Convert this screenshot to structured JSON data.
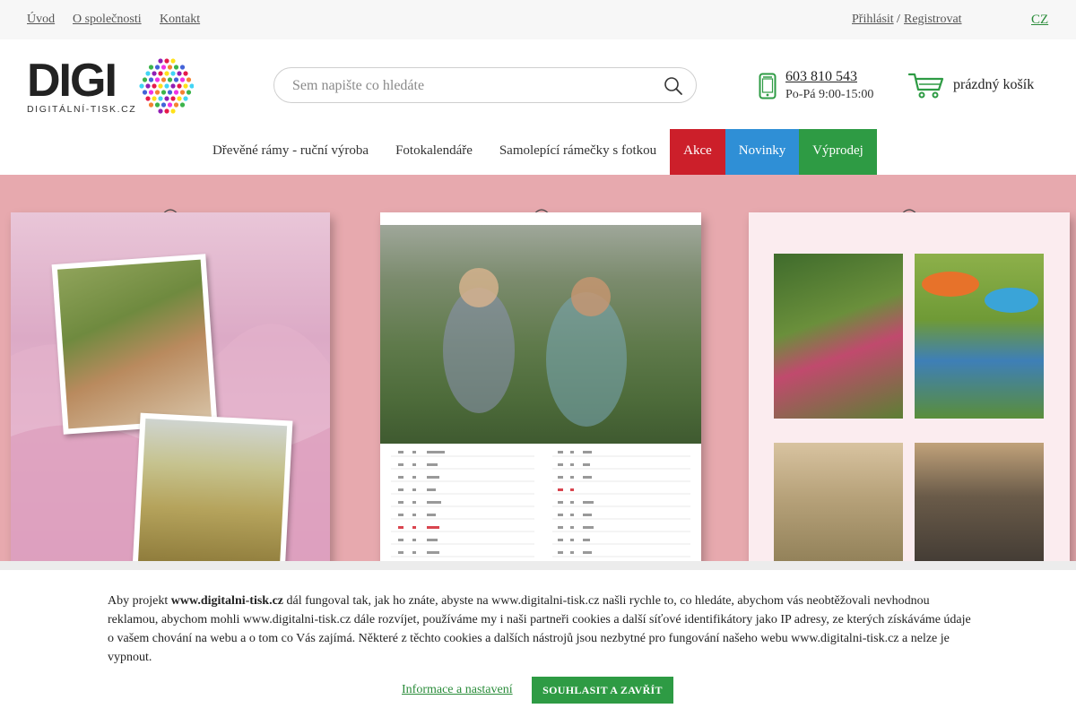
{
  "topbar": {
    "links": [
      "Úvod",
      "O společnosti",
      "Kontakt"
    ],
    "login": "Přihlásit",
    "separator": "/",
    "register": "Registrovat",
    "language": "CZ"
  },
  "header": {
    "logo_text": "DIGI",
    "logo_sub": "DIGITÁLNÍ-TISK.CZ",
    "search_placeholder": "Sem napište co hledáte",
    "phone": "603 810 543",
    "hours": "Po-Pá 9:00-15:00",
    "cart": "prázdný košík"
  },
  "nav": {
    "items": [
      "Dřevěné rámy - ruční výroba",
      "Fotokalendáře",
      "Samolepící rámečky s fotkou",
      "Akce",
      "Novinky",
      "Výprodej"
    ]
  },
  "cookie": {
    "lead": "Aby projekt ",
    "site": "www.digitalni-tisk.cz",
    "text": " dál fungoval tak, jak ho znáte, abyste na www.digitalni-tisk.cz našli rychle to, co hledáte, abychom vás neobtěžovali nevhodnou reklamou, abychom mohli www.digitalni-tisk.cz dále rozvíjet, používáme my i naši partneři cookies a další síťové identifikátory jako IP adresy, ze kterých získáváme údaje o vašem chování na webu a o tom co Vás zajímá. Některé z těchto cookies a dalších nástrojů jsou nezbytné pro fungování našeho webu www.digitalni-tisk.cz a nelze je vypnout.",
    "settings_link": "Informace a nastavení",
    "accept_button": "SOUHLASIT A ZAVŘÍT"
  },
  "colors": {
    "accent_green": "#2e9b44",
    "akce_red": "#cc1f2a",
    "novinky_blue": "#2f8fd6",
    "banner_pink": "#e7a9ae"
  },
  "icons": [
    "search-icon",
    "phone-icon",
    "cart-icon"
  ]
}
